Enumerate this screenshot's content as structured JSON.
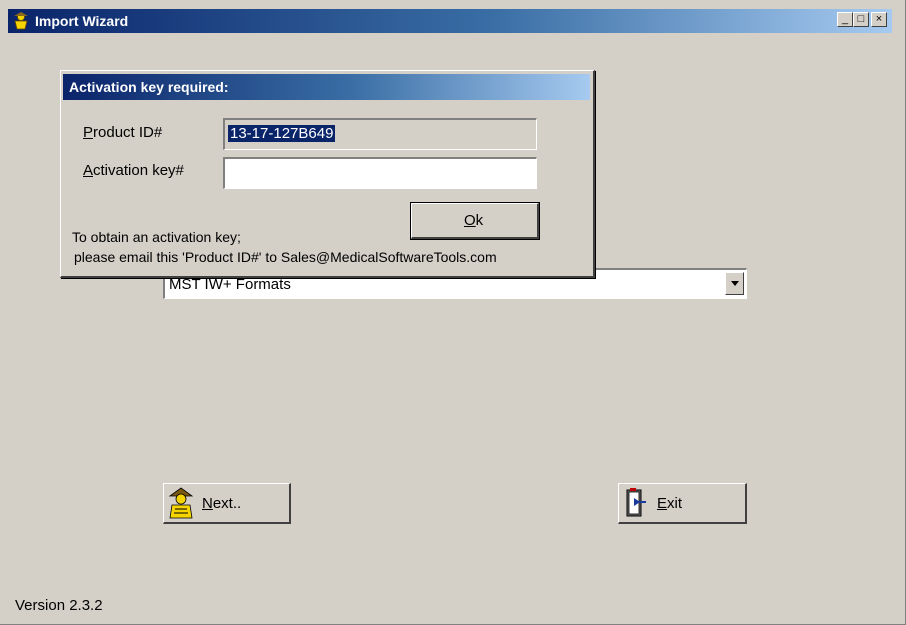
{
  "window": {
    "title": "Import Wizard",
    "controls": {
      "minimize": "_",
      "maximize": "□",
      "close": "×"
    }
  },
  "main": {
    "format_select": {
      "selected": "MST IW+ Formats"
    },
    "next_button": {
      "label_prefix": "N",
      "label_rest": "ext.."
    },
    "exit_button": {
      "label_prefix": "E",
      "label_rest": "xit"
    },
    "version": "Version 2.3.2"
  },
  "dialog": {
    "title": "Activation key required:",
    "product_id": {
      "label_prefix": "P",
      "label_rest": "roduct ID#",
      "value": "13-17-127B649"
    },
    "activation_key": {
      "label_prefix": "A",
      "label_rest": "ctivation key#",
      "value": ""
    },
    "ok_button": {
      "label_prefix": "O",
      "label_rest": "k"
    },
    "info_line1": "To obtain an activation key;",
    "info_line2": "please email this 'Product ID#' to Sales@MedicalSoftwareTools.com"
  },
  "icons": {
    "app": "wizard-figure-icon",
    "next": "wizard-figure-icon",
    "exit": "door-exit-icon"
  }
}
